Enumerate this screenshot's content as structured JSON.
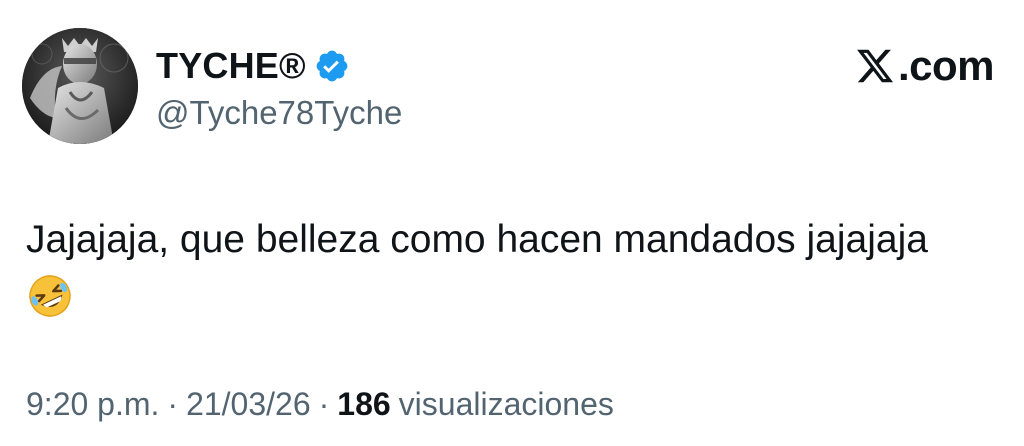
{
  "tweet": {
    "author": {
      "display_name": "TYCHE®",
      "handle": "@Tyche78Tyche",
      "verified": true,
      "verified_icon": "verified-badge-icon",
      "avatar": "statue-avatar"
    },
    "brand": {
      "icon": "x-logo-icon",
      "text": ".com"
    },
    "text": "Jajajaja, que belleza como hacen mandados jajajaja",
    "emoji": "rolling-on-the-floor-laughing-emoji",
    "meta": {
      "time": "9:20 p.m.",
      "separator": "·",
      "date": "21/03/26",
      "views_count": "186",
      "views_label": "visualizaciones"
    },
    "colors": {
      "text": "#0f1419",
      "secondary": "#536471",
      "verified": "#1d9bf0"
    }
  }
}
